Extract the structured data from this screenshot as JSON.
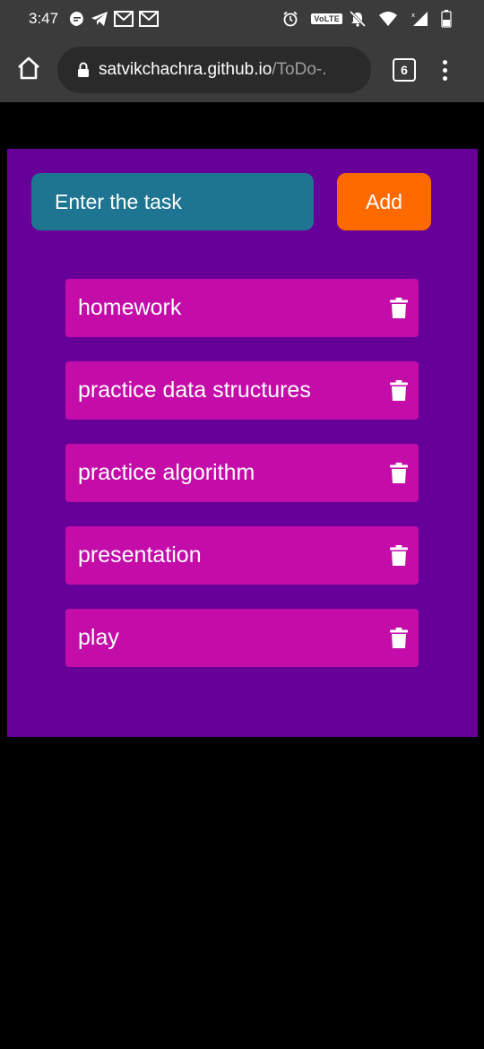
{
  "status_bar": {
    "time": "3:47",
    "volte": "VoLTE",
    "left_icons": [
      "chat-bubble-icon",
      "telegram-icon",
      "gmail-icon",
      "gmail-icon"
    ],
    "right_icons": [
      "alarm-icon",
      "mute-icon",
      "wifi-icon",
      "signal-icon",
      "battery-icon"
    ]
  },
  "browser": {
    "url_domain": "satvikchachra.github.io",
    "url_path": "/ToDo-.",
    "tab_count": "6"
  },
  "app": {
    "input_placeholder": "Enter the task",
    "add_label": "Add",
    "tasks": [
      {
        "text": "homework"
      },
      {
        "text": "practice data structures"
      },
      {
        "text": "practice algorithm"
      },
      {
        "text": "presentation"
      },
      {
        "text": "play"
      }
    ]
  },
  "colors": {
    "app_bg": "#660099",
    "input_bg": "#1e7591",
    "add_bg": "#ff6a00",
    "task_bg": "#c40ca9"
  }
}
